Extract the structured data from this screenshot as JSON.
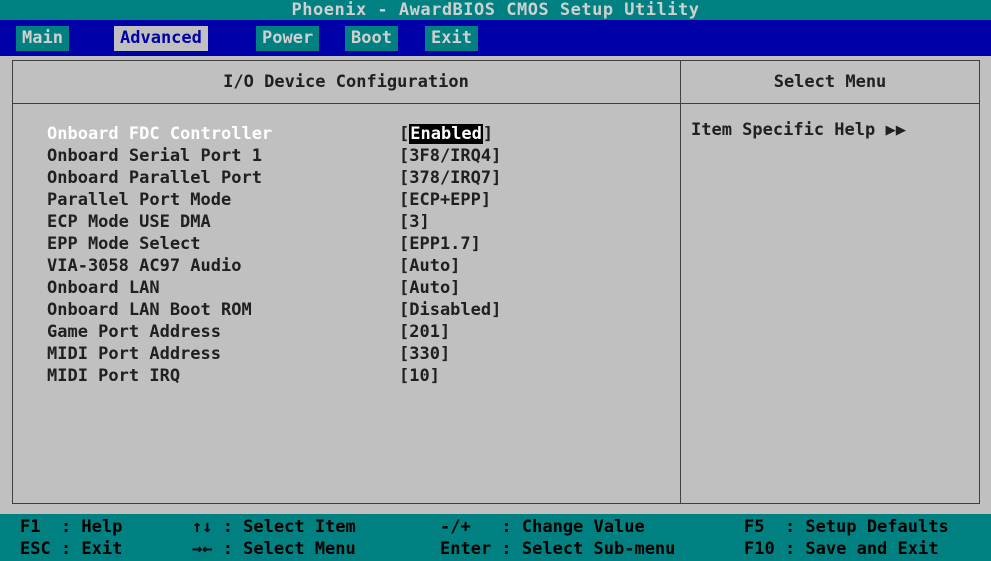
{
  "window": {
    "title": "Phoenix - AwardBIOS CMOS Setup Utility"
  },
  "menu": [
    {
      "label": "Main",
      "state": "inactive"
    },
    {
      "label": "Advanced",
      "state": "active"
    },
    {
      "label": "Power",
      "state": "inactive"
    },
    {
      "label": "Boot",
      "state": "inactive"
    },
    {
      "label": "Exit",
      "state": "inactive"
    }
  ],
  "panel": {
    "title": "I/O Device Configuration",
    "help_title": "Select Menu",
    "help_text": "Item Specific Help ▶▶"
  },
  "settings": [
    {
      "label": "Onboard FDC Controller",
      "value_open": "[",
      "value": "Enabled",
      "value_close": "]"
    },
    {
      "label": "Onboard Serial Port 1",
      "value": "[3F8/IRQ4]"
    },
    {
      "label": "Onboard Parallel Port",
      "value": "[378/IRQ7]"
    },
    {
      "label": "Parallel Port Mode",
      "value": "[ECP+EPP]"
    },
    {
      "label": "ECP Mode USE DMA",
      "value": "[3]"
    },
    {
      "label": "EPP Mode Select",
      "value": "[EPP1.7]"
    },
    {
      "label": "VIA-3058 AC97 Audio",
      "value": "[Auto]"
    },
    {
      "label": "Onboard LAN",
      "value": "[Auto]"
    },
    {
      "label": "Onboard LAN Boot ROM",
      "value": "[Disabled]"
    },
    {
      "label": "Game Port Address",
      "value": "[201]"
    },
    {
      "label": "MIDI Port Address",
      "value": "[330]"
    },
    {
      "label": "MIDI Port IRQ",
      "value": "[10]"
    }
  ],
  "footer": {
    "row1": {
      "col1": "F1  : Help",
      "col2": "↑↓ : Select Item",
      "col3": "-/+   : Change Value",
      "col4": "F5  : Setup Defaults"
    },
    "row2": {
      "col1": "ESC : Exit",
      "col2": "→← : Select Menu",
      "col3": "Enter : Select Sub-menu",
      "col4": "F10 : Save and Exit"
    }
  },
  "colors": {
    "background": "#c0c0c0",
    "menu_bar": "#0000a8",
    "title_footer": "#008080",
    "highlight": "#000000"
  }
}
